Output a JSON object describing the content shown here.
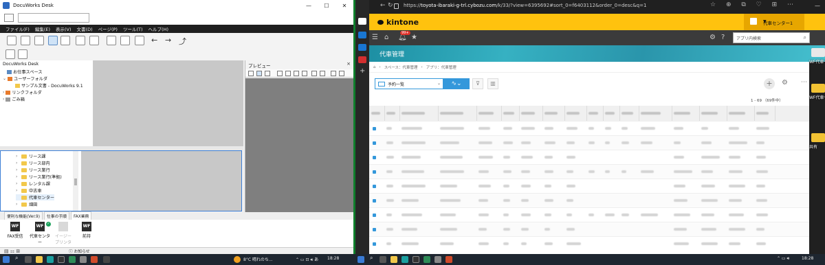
{
  "docuworks": {
    "window_title": "DocuWorks Desk",
    "window_controls": [
      "—",
      "☐",
      "✕"
    ],
    "search": {
      "value": "",
      "placeholder": ""
    },
    "menu": [
      "ファイル(F)",
      "編集(E)",
      "表示(V)",
      "文書(D)",
      "ページ(P)",
      "ツール(T)",
      "ヘルプ(H)"
    ],
    "tree": [
      {
        "label": "DocuWorks Desk",
        "icon": "desk-icon"
      },
      {
        "label": "お仕事スペース",
        "icon": "workspace-icon"
      },
      {
        "label": "ユーザーフォルダ",
        "icon": "user-folder-icon"
      },
      {
        "label": "サンプル文書 - DocuWorks 9.1",
        "icon": "sample-folder-icon"
      },
      {
        "label": "リンクフォルダ",
        "icon": "link-folder-icon"
      },
      {
        "label": "ごみ箱",
        "icon": "trash-icon"
      }
    ],
    "preview_title": "プレビュー",
    "folders": [
      "リース課",
      "リース部内",
      "リース業行",
      "リース業行(準拠)",
      "レンタル課",
      "中古車",
      "代車センター",
      "畑田"
    ],
    "tabs": [
      "便利な機能(Ver.9)",
      "仕事の手順",
      "FAX業務"
    ],
    "active_tab": 2,
    "tray": [
      {
        "label": "FAX受信",
        "box": "WF",
        "enabled": true,
        "checked": false
      },
      {
        "label": "代車センター",
        "box": "WF",
        "enabled": true,
        "checked": true
      },
      {
        "label": "イージープリンタ",
        "box": "",
        "enabled": false,
        "checked": false
      },
      {
        "label": "前持",
        "box": "WF",
        "enabled": true,
        "checked": false
      }
    ],
    "status_notice": "ⓘ お知らせ"
  },
  "edge": {
    "url_prefix": "https://",
    "url_host": "toyota-ibaraki-g-trl.cybozu.com",
    "url_path": "/k/33/?view=6395692#sort_0=f6403112&order_0=desc&q=1",
    "window_controls": [
      "—",
      "☐",
      "✕"
    ]
  },
  "kintone": {
    "logo": "kintone",
    "user": "代車センター1",
    "badge": "99+",
    "search_placeholder": "アプリ内検索",
    "app_title": "代車管理",
    "breadcrumb": [
      "⌂",
      "›",
      "スペース：代車管理",
      "›",
      "アプリ：代車管理"
    ],
    "view_name": "予約一覧",
    "record_count": "1 - 69 （69件中）"
  },
  "desktop_icons": [
    {
      "label": "WF代車センター付"
    },
    {
      "label": "WF代車センター"
    },
    {
      "label": "共有"
    }
  ],
  "taskbar": {
    "weather": "8°C  晴れのち...",
    "time_left": "18:28",
    "time_right": "18:28"
  },
  "colors": {
    "kintone_yellow": "#ffc20e",
    "divider_green": "#0f7f2c",
    "accent_blue": "#3498db"
  }
}
